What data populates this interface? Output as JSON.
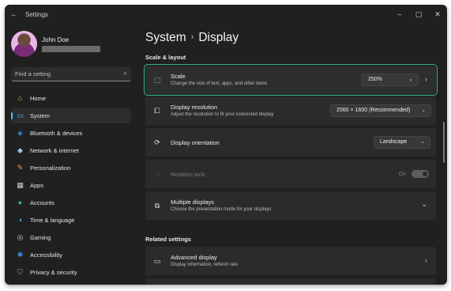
{
  "window": {
    "title": "Settings",
    "back": "←",
    "minimize": "–",
    "maximize": "▢",
    "close": "✕"
  },
  "user": {
    "name": "John Doe"
  },
  "search": {
    "placeholder": "Find a setting",
    "icon": "⌕"
  },
  "sidebar": {
    "items": [
      {
        "label": "Home",
        "icon": "home-icon",
        "color": "#f7c35c",
        "glyph": "⌂",
        "active": false
      },
      {
        "label": "System",
        "icon": "system-icon",
        "color": "#4cc2ff",
        "glyph": "▭",
        "active": true
      },
      {
        "label": "Bluetooth & devices",
        "icon": "bluetooth-icon",
        "color": "#3b8eea",
        "glyph": "◈",
        "active": false
      },
      {
        "label": "Network & internet",
        "icon": "network-icon",
        "color": "#9ec6ff",
        "glyph": "◆",
        "active": false
      },
      {
        "label": "Personalization",
        "icon": "personalization-icon",
        "color": "#e8a75c",
        "glyph": "✎",
        "active": false
      },
      {
        "label": "Apps",
        "icon": "apps-icon",
        "color": "#c8cfd8",
        "glyph": "▦",
        "active": false
      },
      {
        "label": "Accounts",
        "icon": "accounts-icon",
        "color": "#3fb96a",
        "glyph": "●",
        "active": false
      },
      {
        "label": "Time & language",
        "icon": "time-language-icon",
        "color": "#4aa8e8",
        "glyph": "◑",
        "active": false
      },
      {
        "label": "Gaming",
        "icon": "gaming-icon",
        "color": "#c7c7c7",
        "glyph": "◎",
        "active": false
      },
      {
        "label": "Accessibility",
        "icon": "accessibility-icon",
        "color": "#3d8ee6",
        "glyph": "✱",
        "active": false
      },
      {
        "label": "Privacy & security",
        "icon": "shield-icon",
        "color": "#9ea6b0",
        "glyph": "⛉",
        "active": false
      }
    ]
  },
  "breadcrumb": {
    "parent": "System",
    "separator": "›",
    "current": "Display"
  },
  "sections": {
    "scale_layout": "Scale & layout",
    "related": "Related settings"
  },
  "cards": {
    "scale": {
      "title": "Scale",
      "subtitle": "Change the size of text, apps, and other items",
      "value": "250%"
    },
    "resolution": {
      "title": "Display resolution",
      "subtitle": "Adjust the resolution to fit your connected display",
      "value": "2560 × 1600 (Recommended)"
    },
    "orientation": {
      "title": "Display orientation",
      "value": "Landscape"
    },
    "rotation_lock": {
      "title": "Rotation lock",
      "state": "On"
    },
    "multiple_displays": {
      "title": "Multiple displays",
      "subtitle": "Choose the presentation mode for your displays"
    },
    "advanced_display": {
      "title": "Advanced display",
      "subtitle": "Display information, refresh rate"
    }
  },
  "colors": {
    "accent": "#4cc2ff",
    "highlight_border": "#2fb38a",
    "background": "#202020",
    "card": "#2b2b2b"
  }
}
